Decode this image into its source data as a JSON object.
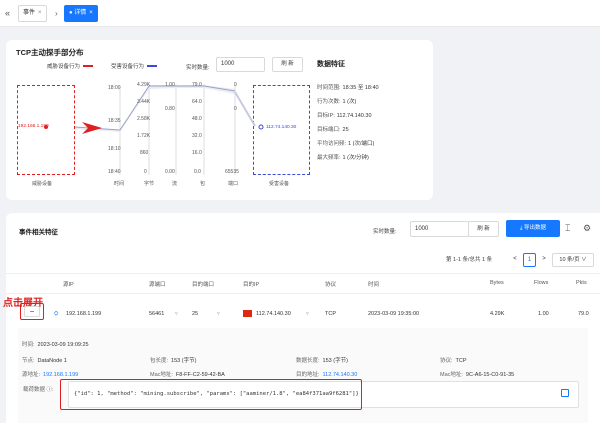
{
  "tabs": [
    {
      "label": "事件",
      "close": "×",
      "active": false
    },
    {
      "label": "● 详情",
      "close": "×",
      "active": true
    }
  ],
  "icons": {
    "back": "double-chevron-left-icon",
    "next": "chevron-right-icon",
    "export": "download-icon",
    "column": "column-setting-icon",
    "settings": "gear-icon",
    "copy": "copy-icon"
  },
  "chart_card": {
    "title": "TCP主动探手部分布",
    "legend_threat": "威胁设备行为",
    "legend_victim": "受害设备行为",
    "count_label": "实时数量:",
    "count_value": "1000",
    "refresh_label": "刷 新",
    "src_ip": "192.168.1.199",
    "src_box_label": "威胁设备",
    "dst_ip": "112.74.140.30",
    "dst_box_label": "受害设备",
    "axes": [
      {
        "label": "时间",
        "top": "18:00",
        "mid1": "18:35",
        "mid2": "18:10",
        "bot": "18:40"
      },
      {
        "label": "字节",
        "top": "4.29K",
        "mid1": "3.44K",
        "mid2": "2.58K",
        "mid3": "1.72K",
        "mid4": "860",
        "bot": "0"
      },
      {
        "label": "流",
        "top": "1.00",
        "mid1": "0.80",
        "bot": "0.00"
      },
      {
        "label": "包",
        "top": "79.0",
        "mid1": "64.0",
        "mid2": "48.0",
        "mid3": "32.0",
        "mid4": "16.0",
        "bot": "0.0"
      },
      {
        "label": "端口",
        "top": "0",
        "mid1": "0",
        "bot": "65535"
      }
    ]
  },
  "stats": {
    "title": "数据特征",
    "rows": [
      {
        "k": "时间范围:",
        "v": "18:35 至 18:40"
      },
      {
        "k": "行为次数:",
        "v": "1 (次)"
      },
      {
        "k": "目标IP:",
        "v": "112.74.140.30"
      },
      {
        "k": "目标端口:",
        "v": "25"
      },
      {
        "k": "平均访问频:",
        "v": "1 (次/端口)"
      },
      {
        "k": "最大频率:",
        "v": "1 (次/分钟)"
      }
    ]
  },
  "events": {
    "title": "事件相关特征",
    "count_label": "实时数量:",
    "count_value": "1000",
    "refresh_label": "刷 新",
    "export_label": "导出数据",
    "pager_text": "第 1-1 条/总共 1 条",
    "page_prev": "<",
    "page_current": "1",
    "page_next": ">",
    "page_size": "10 条/页 ∨",
    "columns": [
      "源IP",
      "源端口",
      "目的端口",
      "目的IP",
      "协议",
      "时间",
      "Bytes",
      "Flows",
      "Pkts"
    ],
    "row": {
      "src_ip": "192.168.1.199",
      "src_port": "56461",
      "dst_port": "25",
      "dst_ip": "112.74.140.30",
      "proto": "TCP",
      "time": "2023-03-09 19:35:00",
      "bytes": "4.29K",
      "flows": "1.00",
      "pkts": "79.0"
    },
    "expand_symbol": "−",
    "annotation": "点击展开"
  },
  "detail": {
    "time_k": "时间:",
    "time_v": "2023-03-09 19:09:25",
    "sensor_k": "节点:",
    "sensor_v": "DataNode 1",
    "pktlen_k": "包长度:",
    "pktlen_v": "153 (字节)",
    "datalen_k": "数据长度:",
    "datalen_v": "153 (字节)",
    "proto_k": "协议:",
    "proto_v": "TCP",
    "srcaddr_k": "源地址:",
    "srcaddr_v": "192.168.1.199",
    "mac_k": "Mac地址:",
    "mac_v": "F8-FF-C2-59-42-BA",
    "dstaddr_k": "目的地址:",
    "dstaddr_v": "112.74.140.30",
    "mac2_k": "Mac地址:",
    "mac2_v": "9C-A6-15-C0-91-35",
    "payload_k": "载荷数据 ⓘ:",
    "payload_v": "{\"id\": 1, \"method\": \"mining.subscribe\", \"params\": [\"aaminer/1.8\", \"ea84f371aa9f6281\"]}"
  },
  "colors": {
    "accent": "#1677ff",
    "threat": "#e02020",
    "victim": "#3b4bd8",
    "highlight": "#e02020"
  }
}
